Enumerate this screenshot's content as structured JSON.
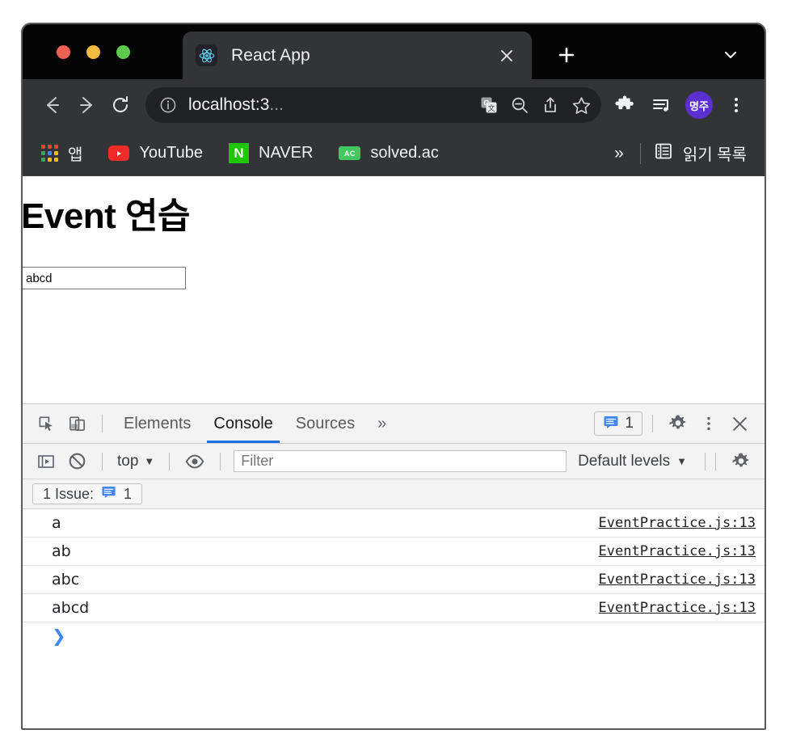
{
  "browser": {
    "tab": {
      "title": "React App",
      "favicon": "react-logo-icon",
      "close_label": "✕"
    },
    "new_tab_label": "+",
    "tab_search_label": "⌄",
    "toolbar": {
      "back_label": "←",
      "forward_label": "→",
      "reload_label": "↻",
      "site_info_label": "ⓘ",
      "url_visible": "localhost:3",
      "url_ellipsis": "...",
      "translate_label": "translate-icon",
      "zoom_out_label": "zoom-out-icon",
      "share_label": "share-icon",
      "bookmark_star_label": "☆",
      "extensions_label": "extensions-puzzle-icon",
      "media_label": "media-list-icon",
      "profile_initials": "명주",
      "menu_label": "⋮"
    },
    "bookmarks": {
      "apps_label": "앱",
      "items": [
        {
          "label": "YouTube",
          "favicon": "youtube-icon"
        },
        {
          "label": "NAVER",
          "favicon": "naver-icon"
        },
        {
          "label": "solved.ac",
          "favicon": "solvedac-icon"
        }
      ],
      "overflow_label": "»",
      "reading_list_label": "읽기 목록",
      "naver_initial": "N",
      "solvedac_initial": "AC"
    }
  },
  "page": {
    "heading": "Event 연습",
    "input_value": "abcd",
    "input_placeholder": ""
  },
  "devtools": {
    "inspect_icon": "inspect-element-icon",
    "device_toolbar_icon": "device-toolbar-icon",
    "tabs": [
      {
        "label": "Elements",
        "active": false
      },
      {
        "label": "Console",
        "active": true
      },
      {
        "label": "Sources",
        "active": false
      }
    ],
    "more_tabs_label": "»",
    "issues_count": "1",
    "settings_label": "gear-icon",
    "more_options_label": "⋮",
    "close_label": "✕",
    "console_toolbar": {
      "sidebar_toggle": "console-sidebar-icon",
      "clear_label": "clear-console-icon",
      "context": "top",
      "context_caret": "▼",
      "eye_label": "live-expression-icon",
      "filter_placeholder": "Filter",
      "filter_value": "",
      "levels": "Default levels",
      "levels_caret": "▼",
      "console_settings_label": "gear-icon"
    },
    "issues_bar": {
      "label": "1 Issue:",
      "count": "1"
    },
    "messages": [
      {
        "text": "a",
        "source": "EventPractice.js:13"
      },
      {
        "text": "ab",
        "source": "EventPractice.js:13"
      },
      {
        "text": "abc",
        "source": "EventPractice.js:13"
      },
      {
        "text": "abcd",
        "source": "EventPractice.js:13"
      }
    ],
    "prompt_caret": "❯"
  },
  "colors": {
    "chrome_dark": "#333436",
    "tab_strip": "#050505",
    "accent_blue": "#1a73e8",
    "profile_purple": "#5b2fd1",
    "issue_blue": "#4285f4"
  }
}
